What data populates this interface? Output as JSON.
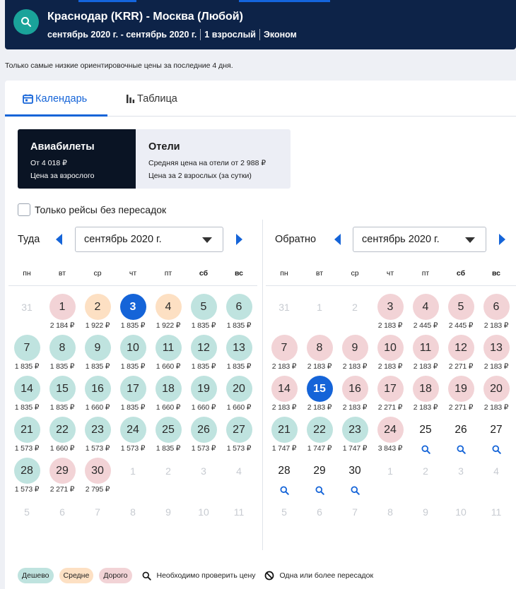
{
  "header": {
    "route": "Краснодар (KRR) - Москва (Любой)",
    "dates": "сентябрь 2020 г. - сентябрь 2020 г.",
    "passengers": "1 взрослый",
    "cabin": "Эконом",
    "colors": {
      "background": "#0d2348",
      "accent": "#1465dd",
      "search_button": "#1aa39a"
    },
    "search_icon": "search-icon"
  },
  "note": "Только самые низкие ориентировочные цены за последние 4 дня.",
  "tabs": [
    {
      "label": "Календарь",
      "icon": "calendar-icon",
      "active": true
    },
    {
      "label": "Таблица",
      "icon": "bar-chart-icon",
      "active": false
    }
  ],
  "cards": {
    "flights": {
      "title": "Авиабилеты",
      "price": "От 4 018 ₽",
      "sub": "Цена за взрослого"
    },
    "hotels": {
      "title": "Отели",
      "price": "Средняя цена на отели от 2 988 ₽",
      "sub": "Цена за 2 взрослых (за сутки)"
    }
  },
  "direct_only": {
    "label": "Только рейсы без пересадок",
    "checked": false
  },
  "weekdays": [
    "пн",
    "вт",
    "ср",
    "чт",
    "пт",
    "сб",
    "вс"
  ],
  "depart": {
    "label": "Туда",
    "month": "сентябрь 2020 г.",
    "days": [
      {
        "d": "31",
        "t": "off"
      },
      {
        "d": "1",
        "p": "2 184 ₽",
        "t": "red"
      },
      {
        "d": "2",
        "p": "1 922 ₽",
        "t": "orange"
      },
      {
        "d": "3",
        "p": "1 835 ₽",
        "t": "sel"
      },
      {
        "d": "4",
        "p": "1 922 ₽",
        "t": "orange"
      },
      {
        "d": "5",
        "p": "1 835 ₽",
        "t": "green"
      },
      {
        "d": "6",
        "p": "1 835 ₽",
        "t": "green"
      },
      {
        "d": "7",
        "p": "1 835 ₽",
        "t": "green"
      },
      {
        "d": "8",
        "p": "1 835 ₽",
        "t": "green"
      },
      {
        "d": "9",
        "p": "1 835 ₽",
        "t": "green"
      },
      {
        "d": "10",
        "p": "1 835 ₽",
        "t": "green"
      },
      {
        "d": "11",
        "p": "1 660 ₽",
        "t": "green"
      },
      {
        "d": "12",
        "p": "1 835 ₽",
        "t": "green"
      },
      {
        "d": "13",
        "p": "1 835 ₽",
        "t": "green"
      },
      {
        "d": "14",
        "p": "1 835 ₽",
        "t": "green"
      },
      {
        "d": "15",
        "p": "1 835 ₽",
        "t": "green"
      },
      {
        "d": "16",
        "p": "1 660 ₽",
        "t": "green"
      },
      {
        "d": "17",
        "p": "1 835 ₽",
        "t": "green"
      },
      {
        "d": "18",
        "p": "1 660 ₽",
        "t": "green"
      },
      {
        "d": "19",
        "p": "1 660 ₽",
        "t": "green"
      },
      {
        "d": "20",
        "p": "1 660 ₽",
        "t": "green"
      },
      {
        "d": "21",
        "p": "1 573 ₽",
        "t": "green"
      },
      {
        "d": "22",
        "p": "1 660 ₽",
        "t": "green"
      },
      {
        "d": "23",
        "p": "1 573 ₽",
        "t": "green"
      },
      {
        "d": "24",
        "p": "1 573 ₽",
        "t": "green"
      },
      {
        "d": "25",
        "p": "1 835 ₽",
        "t": "green"
      },
      {
        "d": "26",
        "p": "1 573 ₽",
        "t": "green"
      },
      {
        "d": "27",
        "p": "1 573 ₽",
        "t": "green"
      },
      {
        "d": "28",
        "p": "1 573 ₽",
        "t": "green"
      },
      {
        "d": "29",
        "p": "2 271 ₽",
        "t": "red"
      },
      {
        "d": "30",
        "p": "2 795 ₽",
        "t": "red"
      },
      {
        "d": "1",
        "t": "off"
      },
      {
        "d": "2",
        "t": "off"
      },
      {
        "d": "3",
        "t": "off"
      },
      {
        "d": "4",
        "t": "off"
      },
      {
        "d": "5",
        "t": "off"
      },
      {
        "d": "6",
        "t": "off"
      },
      {
        "d": "7",
        "t": "off"
      },
      {
        "d": "8",
        "t": "off"
      },
      {
        "d": "9",
        "t": "off"
      },
      {
        "d": "10",
        "t": "off"
      },
      {
        "d": "11",
        "t": "off"
      }
    ]
  },
  "return": {
    "label": "Обратно",
    "month": "сентябрь 2020 г.",
    "days": [
      {
        "d": "31",
        "t": "off"
      },
      {
        "d": "1",
        "t": "off"
      },
      {
        "d": "2",
        "t": "off"
      },
      {
        "d": "3",
        "p": "2 183 ₽",
        "t": "red"
      },
      {
        "d": "4",
        "p": "2 445 ₽",
        "t": "red"
      },
      {
        "d": "5",
        "p": "2 445 ₽",
        "t": "red"
      },
      {
        "d": "6",
        "p": "2 183 ₽",
        "t": "red"
      },
      {
        "d": "7",
        "p": "2 183 ₽",
        "t": "red"
      },
      {
        "d": "8",
        "p": "2 183 ₽",
        "t": "red"
      },
      {
        "d": "9",
        "p": "2 183 ₽",
        "t": "red"
      },
      {
        "d": "10",
        "p": "2 183 ₽",
        "t": "red"
      },
      {
        "d": "11",
        "p": "2 183 ₽",
        "t": "red"
      },
      {
        "d": "12",
        "p": "2 271 ₽",
        "t": "red"
      },
      {
        "d": "13",
        "p": "2 183 ₽",
        "t": "red"
      },
      {
        "d": "14",
        "p": "2 183 ₽",
        "t": "red"
      },
      {
        "d": "15",
        "p": "2 183 ₽",
        "t": "sel"
      },
      {
        "d": "16",
        "p": "2 183 ₽",
        "t": "red"
      },
      {
        "d": "17",
        "p": "2 271 ₽",
        "t": "red"
      },
      {
        "d": "18",
        "p": "2 183 ₽",
        "t": "red"
      },
      {
        "d": "19",
        "p": "2 271 ₽",
        "t": "red"
      },
      {
        "d": "20",
        "p": "2 183 ₽",
        "t": "red"
      },
      {
        "d": "21",
        "p": "1 747 ₽",
        "t": "green"
      },
      {
        "d": "22",
        "p": "1 747 ₽",
        "t": "green"
      },
      {
        "d": "23",
        "p": "1 747 ₽",
        "t": "green"
      },
      {
        "d": "24",
        "p": "3 843 ₽",
        "t": "red"
      },
      {
        "d": "25",
        "t": "check"
      },
      {
        "d": "26",
        "t": "check"
      },
      {
        "d": "27",
        "t": "check"
      },
      {
        "d": "28",
        "t": "check"
      },
      {
        "d": "29",
        "t": "check"
      },
      {
        "d": "30",
        "t": "check"
      },
      {
        "d": "1",
        "t": "off"
      },
      {
        "d": "2",
        "t": "off"
      },
      {
        "d": "3",
        "t": "off"
      },
      {
        "d": "4",
        "t": "off"
      },
      {
        "d": "5",
        "t": "off"
      },
      {
        "d": "6",
        "t": "off"
      },
      {
        "d": "7",
        "t": "off"
      },
      {
        "d": "8",
        "t": "off"
      },
      {
        "d": "9",
        "t": "off"
      },
      {
        "d": "10",
        "t": "off"
      },
      {
        "d": "11",
        "t": "off"
      }
    ]
  },
  "legend": {
    "cheap": "Дешево",
    "medium": "Средне",
    "expensive": "Дорого",
    "check_price": "Необходимо проверить цену",
    "stops": "Одна или более пересадок",
    "colors": {
      "cheap": "#bfe3df",
      "medium": "#fde0c3",
      "expensive": "#f2d3d6",
      "selected": "#1564d8"
    }
  }
}
